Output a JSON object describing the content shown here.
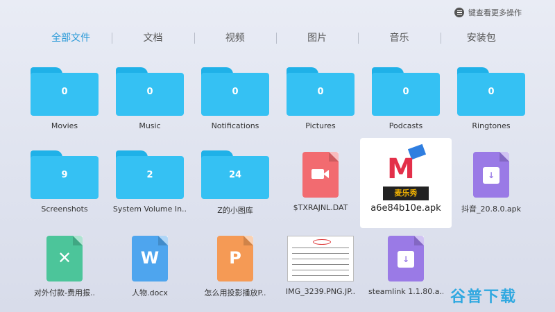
{
  "hint": {
    "text": "键查看更多操作",
    "icon": "menu-icon"
  },
  "tabs": [
    {
      "label": "全部文件",
      "active": true
    },
    {
      "label": "文档"
    },
    {
      "label": "视频"
    },
    {
      "label": "图片"
    },
    {
      "label": "音乐"
    },
    {
      "label": "安装包"
    }
  ],
  "folders": [
    {
      "name": "Movies",
      "count": "0"
    },
    {
      "name": "Music",
      "count": "0"
    },
    {
      "name": "Notifications",
      "count": "0"
    },
    {
      "name": "Pictures",
      "count": "0"
    },
    {
      "name": "Podcasts",
      "count": "0"
    },
    {
      "name": "Ringtones",
      "count": "0"
    },
    {
      "name": "Screenshots",
      "count": "9"
    },
    {
      "name": "System Volume In..",
      "count": "2"
    },
    {
      "name": "Z的小图库",
      "count": "24"
    }
  ],
  "files": [
    {
      "name": "$TXRAJNL.DAT",
      "type": "video",
      "icon": "video-file-icon"
    },
    {
      "name": "a6e84b10e.apk",
      "type": "app",
      "icon": "app-logo",
      "selected": true,
      "logo_text": "麦乐秀"
    },
    {
      "name": "抖音_20.8.0.apk",
      "type": "apk",
      "icon": "apk-file-icon"
    },
    {
      "name": "对外付款-费用报..",
      "type": "excel",
      "icon": "excel-file-icon"
    },
    {
      "name": "人物.docx",
      "type": "word",
      "icon": "word-file-icon"
    },
    {
      "name": "怎么用投影播放P..",
      "type": "ppt",
      "icon": "ppt-file-icon"
    },
    {
      "name": "IMG_3239.PNG.JP..",
      "type": "image",
      "icon": "image-thumbnail"
    },
    {
      "name": "steamlink 1.1.80.a..",
      "type": "apk",
      "icon": "apk-file-icon"
    }
  ],
  "watermark": "谷普下载",
  "colors": {
    "accent": "#2a9ad8",
    "folder": "#35c1f3"
  }
}
